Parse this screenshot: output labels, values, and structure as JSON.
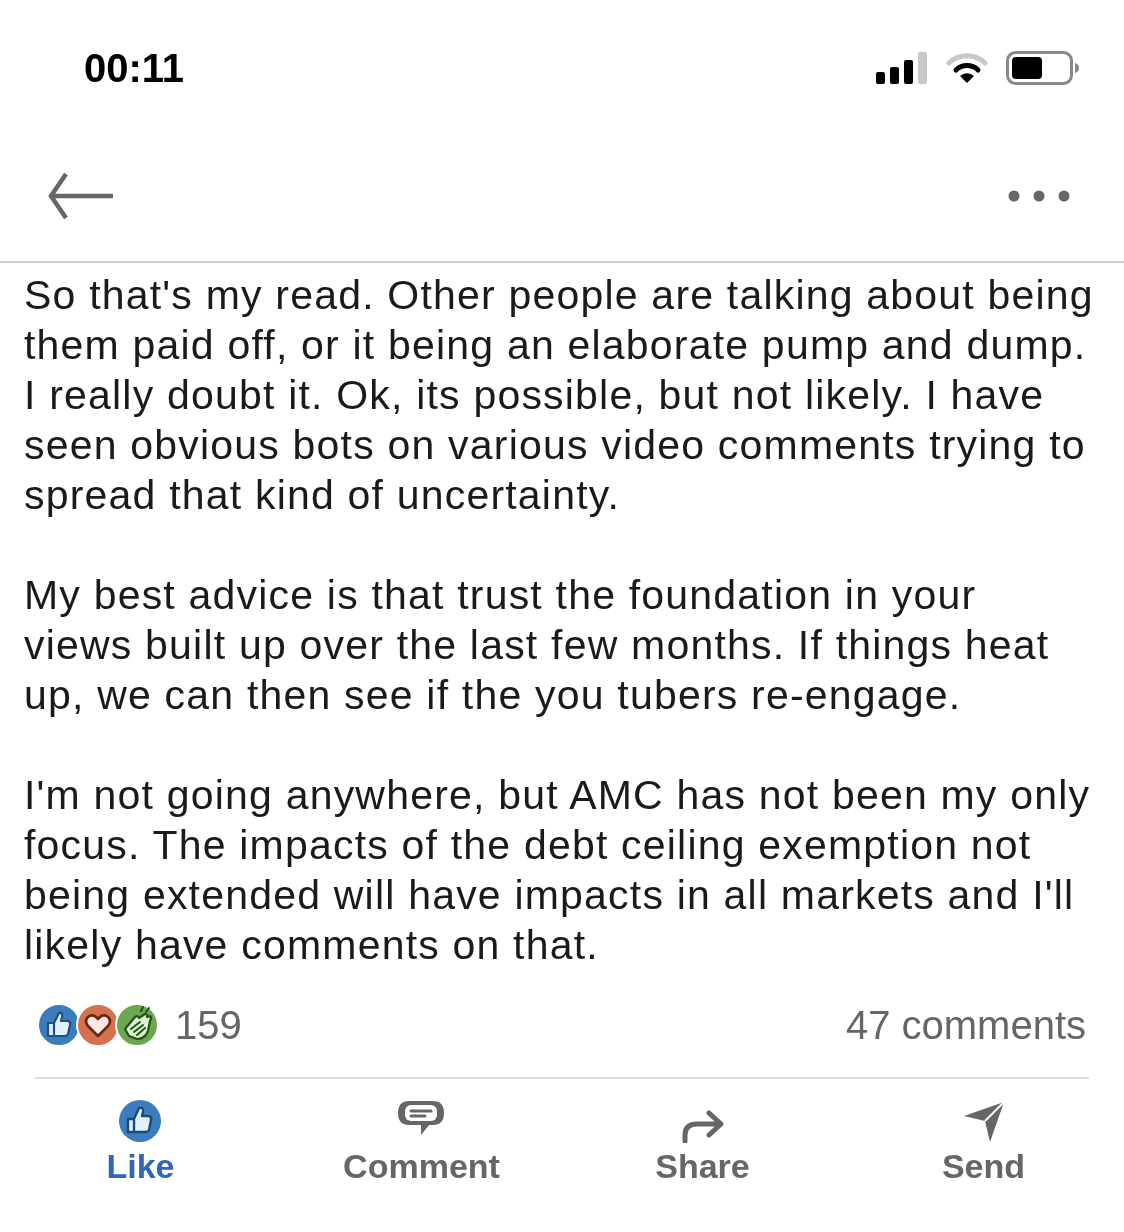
{
  "status_bar": {
    "time": "00:11"
  },
  "post": {
    "paragraphs": [
      "So that's my read. Other people are talking about being them paid off, or it being an elaborate pump and dump. I really doubt it. Ok, its possible, but not likely. I have seen obvious bots on various video comments trying to spread that kind of uncertainty.",
      "My best advice is that trust the foundation in your views built up over the last few months. If things heat up, we can then see if the you tubers re-engage.",
      "I'm not going anywhere, but AMC has not been my only focus. The impacts of the debt ceiling exemption not being extended will have impacts in all markets and I'll likely have comments on that."
    ]
  },
  "social_counts": {
    "reactions": [
      {
        "kind": "like"
      },
      {
        "kind": "love"
      },
      {
        "kind": "celebrate"
      }
    ],
    "reaction_count": "159",
    "comments": "47 comments"
  },
  "actions": [
    {
      "kind": "like",
      "label": "Like",
      "selected": true
    },
    {
      "kind": "comment",
      "label": "Comment",
      "selected": false
    },
    {
      "kind": "share",
      "label": "Share",
      "selected": false
    },
    {
      "kind": "send",
      "label": "Send",
      "selected": false
    }
  ]
}
